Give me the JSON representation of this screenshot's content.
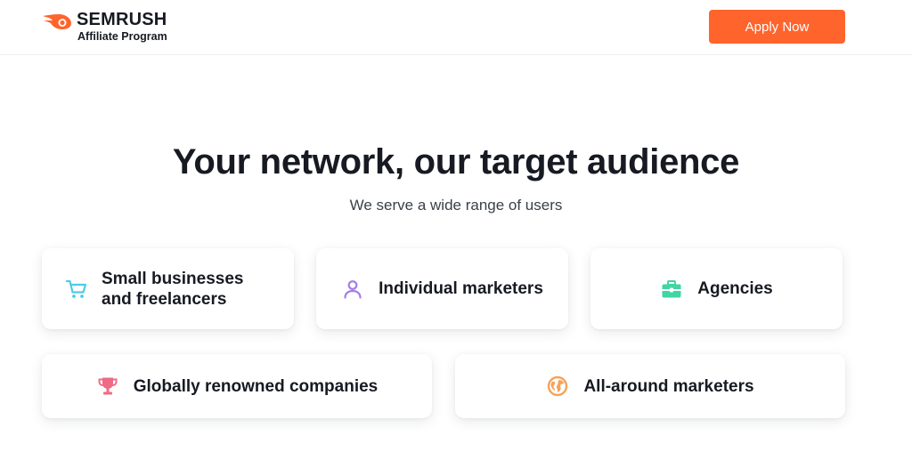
{
  "header": {
    "brand_name": "SEMRUSH",
    "brand_sub": "Affiliate Program",
    "apply_label": "Apply Now"
  },
  "hero": {
    "title": "Your network, our target audience",
    "subtitle": "We serve a wide range of users"
  },
  "audiences": [
    {
      "label_line1": "Small businesses",
      "label_line2": "and freelancers",
      "icon": "cart-icon",
      "icon_color": "#4ecbe8"
    },
    {
      "label": "Individual marketers",
      "icon": "person-icon",
      "icon_color": "#a47ee8"
    },
    {
      "label": "Agencies",
      "icon": "briefcase-icon",
      "icon_color": "#3fd6a4"
    },
    {
      "label": "Globally renowned companies",
      "icon": "trophy-icon",
      "icon_color": "#ef6a84"
    },
    {
      "label": "All-around marketers",
      "icon": "globe-icon",
      "icon_color": "#f5a25a"
    }
  ],
  "colors": {
    "accent": "#ff642d",
    "text": "#171a22"
  }
}
